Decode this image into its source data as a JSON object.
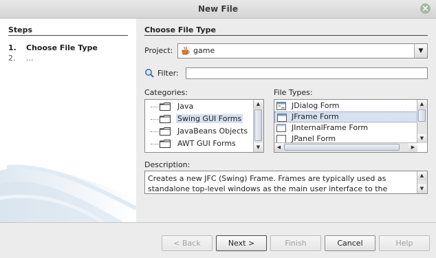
{
  "window": {
    "title": "New File",
    "close": "×"
  },
  "steps": {
    "heading": "Steps",
    "items": [
      {
        "num": "1.",
        "label": "Choose File Type"
      },
      {
        "num": "2.",
        "label": "..."
      }
    ]
  },
  "panel": {
    "heading": "Choose File Type",
    "project_label": "Project:",
    "project_value": "game",
    "filter_label": "Filter:",
    "filter_value": "",
    "categories_label": "Categories:",
    "categories": [
      {
        "label": "Java",
        "selected": false
      },
      {
        "label": "Swing GUI Forms",
        "selected": true
      },
      {
        "label": "JavaBeans Objects",
        "selected": false
      },
      {
        "label": "AWT GUI Forms",
        "selected": false
      }
    ],
    "file_types_label": "File Types:",
    "file_types": [
      {
        "label": "JDialog Form",
        "selected": false
      },
      {
        "label": "JFrame Form",
        "selected": true
      },
      {
        "label": "JInternalFrame Form",
        "selected": false
      },
      {
        "label": "JPanel Form",
        "selected": false
      }
    ],
    "description_label": "Description:",
    "description": "Creates a new JFC (Swing) Frame. Frames are typically used as standalone top-level windows as the main user interface to the"
  },
  "buttons": {
    "back": "< Back",
    "next": "Next >",
    "finish": "Finish",
    "cancel": "Cancel",
    "help": "Help"
  },
  "icons": {
    "project": "java-cup-icon",
    "filter": "magnifier-icon",
    "category": "folder-icon",
    "file_type": "form-icon"
  }
}
